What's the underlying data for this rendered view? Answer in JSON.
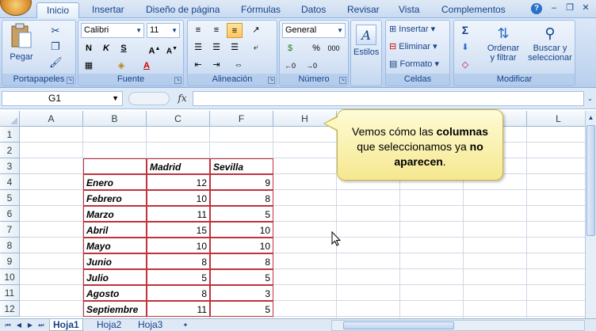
{
  "ribbon_tabs": [
    "Inicio",
    "Insertar",
    "Diseño de página",
    "Fórmulas",
    "Datos",
    "Revisar",
    "Vista",
    "Complementos"
  ],
  "groups": {
    "portapapeles": {
      "label": "Portapapeles",
      "paste": "Pegar"
    },
    "fuente": {
      "label": "Fuente",
      "font": "Calibri",
      "size": "11",
      "bold": "N",
      "italic": "K",
      "underline": "S"
    },
    "alineacion": {
      "label": "Alineación"
    },
    "numero": {
      "label": "Número",
      "format": "General",
      "percent": "%",
      "thousands": "000"
    },
    "estilos": {
      "label": "Estilos"
    },
    "celdas": {
      "label": "Celdas",
      "insert": "Insertar",
      "delete": "Eliminar",
      "format": "Formato"
    },
    "modificar": {
      "label": "Modificar",
      "sort_line1": "Ordenar",
      "sort_line2": "y filtrar",
      "find_line1": "Buscar y",
      "find_line2": "seleccionar"
    }
  },
  "formula_bar": {
    "name_box": "G1",
    "fx": "fx",
    "formula": ""
  },
  "columns": [
    "A",
    "B",
    "C",
    "F",
    "H",
    "L"
  ],
  "rows": [
    "1",
    "2",
    "3",
    "4",
    "5",
    "6",
    "7",
    "8",
    "9",
    "10",
    "11",
    "12"
  ],
  "table": {
    "header": [
      "",
      "Madrid",
      "Sevilla"
    ],
    "data": [
      [
        "Enero",
        "12",
        "9"
      ],
      [
        "Febrero",
        "10",
        "8"
      ],
      [
        "Marzo",
        "11",
        "5"
      ],
      [
        "Abril",
        "15",
        "10"
      ],
      [
        "Mayo",
        "10",
        "10"
      ],
      [
        "Junio",
        "8",
        "8"
      ],
      [
        "Julio",
        "5",
        "5"
      ],
      [
        "Agosto",
        "8",
        "3"
      ],
      [
        "Septiembre",
        "11",
        "5"
      ]
    ]
  },
  "callout": {
    "part1": "Vemos cómo las ",
    "bold1": "columnas",
    "part2": " que seleccionamos ya ",
    "bold2": "no aparecen",
    "part3": "."
  },
  "sheets": [
    "Hoja1",
    "Hoja2",
    "Hoja3"
  ],
  "colors": {
    "tab_accent": "#15428b",
    "table_border": "#c0323c",
    "callout_bg": "#fff7c2"
  }
}
